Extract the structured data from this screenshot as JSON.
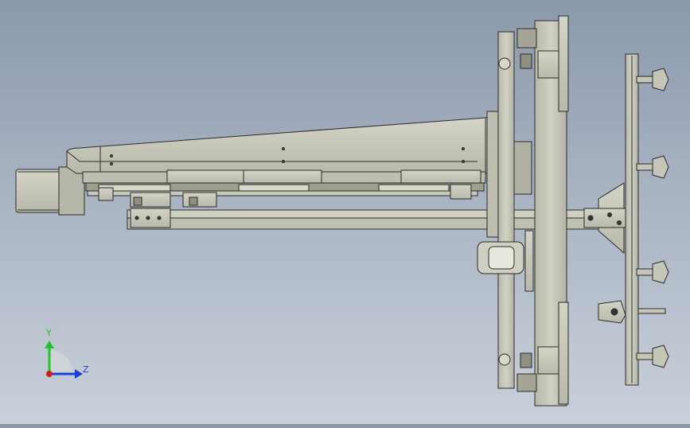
{
  "viewport": {
    "background_top": "#8b99ac",
    "background_bottom": "#c9d0da",
    "part_fill": "#c6c6b8",
    "part_fill_dark": "#a9a99b",
    "edge_color": "#2b2b2b"
  },
  "triad": {
    "y_label": "Y",
    "z_label": "Z",
    "y_color": "#21c42a",
    "z_color": "#1d3fd6",
    "x_color": "#d11d1d"
  },
  "icons": [
    "coordinate-triad-icon"
  ]
}
